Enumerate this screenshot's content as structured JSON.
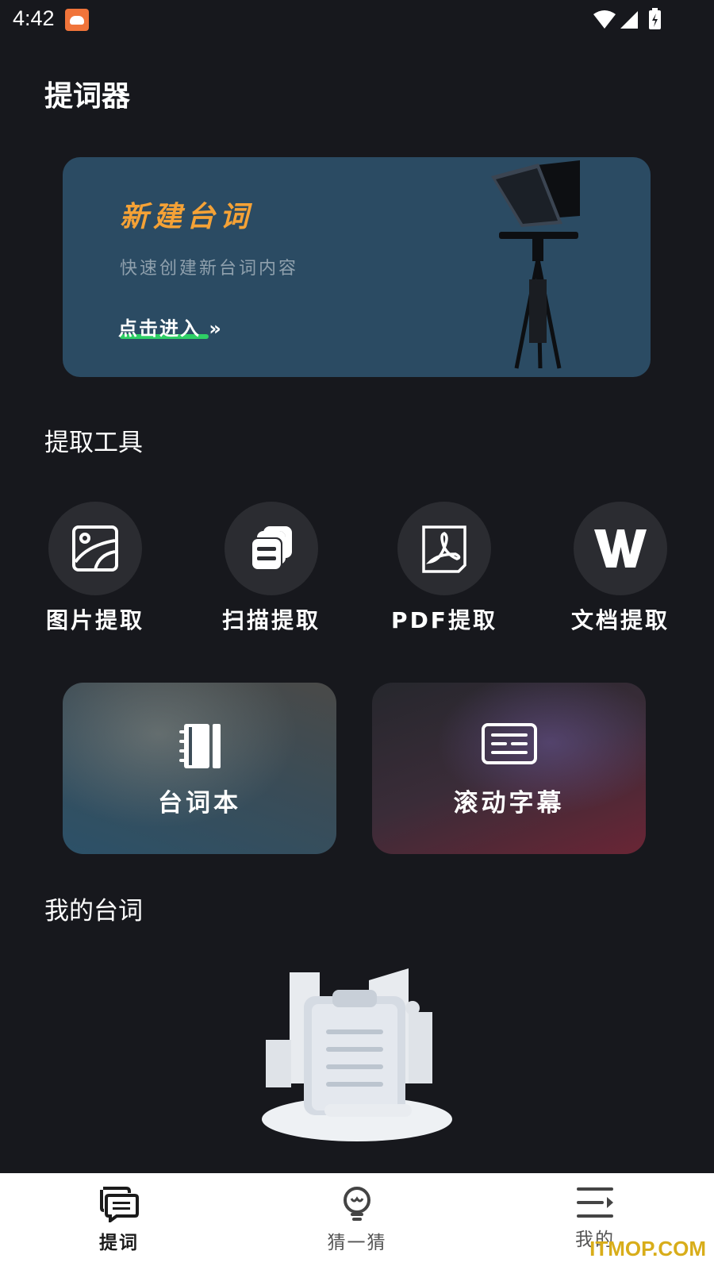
{
  "status_bar": {
    "time": "4:42",
    "icons": [
      "app-notification-icon",
      "wifi-icon",
      "signal-icon",
      "battery-charging-icon"
    ]
  },
  "header": {
    "title": "提词器"
  },
  "banner": {
    "title": "新建台词",
    "subtitle": "快速创建新台词内容",
    "cta": "点击进入 »",
    "accent_color": "#f5a236",
    "underline_color": "#2ecf65"
  },
  "extract_section": {
    "title": "提取工具",
    "tools": [
      {
        "label": "图片提取",
        "icon": "image-icon"
      },
      {
        "label": "扫描提取",
        "icon": "scan-documents-icon"
      },
      {
        "label": "PDF提取",
        "icon": "pdf-icon"
      },
      {
        "label": "文档提取",
        "icon": "word-doc-icon"
      }
    ]
  },
  "cards": [
    {
      "label": "台词本",
      "icon": "notebook-icon"
    },
    {
      "label": "滚动字幕",
      "icon": "subtitles-icon"
    }
  ],
  "my_lines": {
    "title": "我的台词",
    "empty_icon": "empty-clipboard-illustration"
  },
  "bottom_nav": [
    {
      "label": "提词",
      "icon": "chat-lines-icon",
      "active": true
    },
    {
      "label": "猜一猜",
      "icon": "lightbulb-icon",
      "active": false
    },
    {
      "label": "我的",
      "icon": "menu-icon",
      "active": false
    }
  ],
  "watermark": "ITMOP.COM",
  "colors": {
    "background": "#17181d",
    "banner": "#2b4b63",
    "tool_circle": "#2b2c31"
  }
}
